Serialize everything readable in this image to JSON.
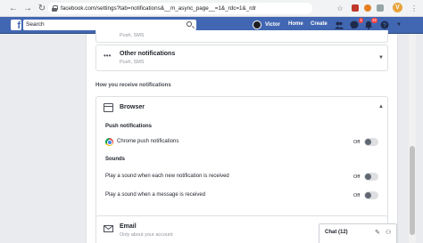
{
  "browser": {
    "url": "facebook.com/settings?tab=notifications&__m_async_page__=1&_rdc=1&_rdr",
    "back": "←",
    "forward": "→",
    "reload": "↻",
    "star": "☆",
    "profile_initial": "V"
  },
  "fb": {
    "logo": "f",
    "search_placeholder": "Search",
    "user_name": "Victor",
    "nav_home": "Home",
    "nav_create": "Create",
    "badge_messages": "1",
    "badge_notifications": "22"
  },
  "settings": {
    "top_row_sub": "Push, SMS",
    "other": {
      "title": "Other notifications",
      "sub": "Push, SMS"
    },
    "how_receive": "How you receive notifications",
    "browser": {
      "title": "Browser",
      "push_heading": "Push notifications",
      "chrome_push": "Chrome push notifications",
      "chrome_push_state": "Off",
      "sounds_heading": "Sounds",
      "sound_new_notif": "Play a sound when each new notification is received",
      "sound_new_notif_state": "Off",
      "sound_message": "Play a sound when a message is received",
      "sound_message_state": "Off"
    },
    "email": {
      "title": "Email",
      "sub": "Only about your account"
    }
  },
  "chat": {
    "label": "Chat (12)"
  }
}
